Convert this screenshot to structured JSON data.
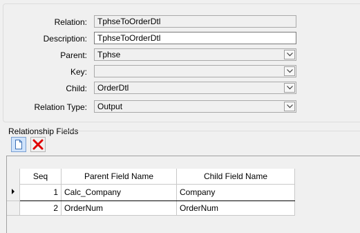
{
  "form": {
    "relation": {
      "label": "Relation:",
      "value": "TphseToOrderDtl"
    },
    "description": {
      "label": "Description:",
      "value": "TphseToOrderDtl"
    },
    "parent": {
      "label": "Parent:",
      "value": "Tphse"
    },
    "key": {
      "label": "Key:",
      "value": ""
    },
    "child": {
      "label": "Child:",
      "value": "OrderDtl"
    },
    "relation_type": {
      "label": "Relation Type:",
      "value": "Output"
    }
  },
  "fields_group": {
    "title": "Relationship Fields",
    "toolbar": {
      "new_icon": "new-document-icon",
      "delete_icon": "delete-x-icon",
      "delete_color": "#e00000"
    }
  },
  "grid": {
    "headers": {
      "seq": "Seq",
      "parent": "Parent Field Name",
      "child": "Child Field Name"
    },
    "rows": [
      {
        "seq": "1",
        "parent": "Calc_Company",
        "child": "Company"
      },
      {
        "seq": "2",
        "parent": "OrderNum",
        "child": "OrderNum"
      }
    ]
  }
}
